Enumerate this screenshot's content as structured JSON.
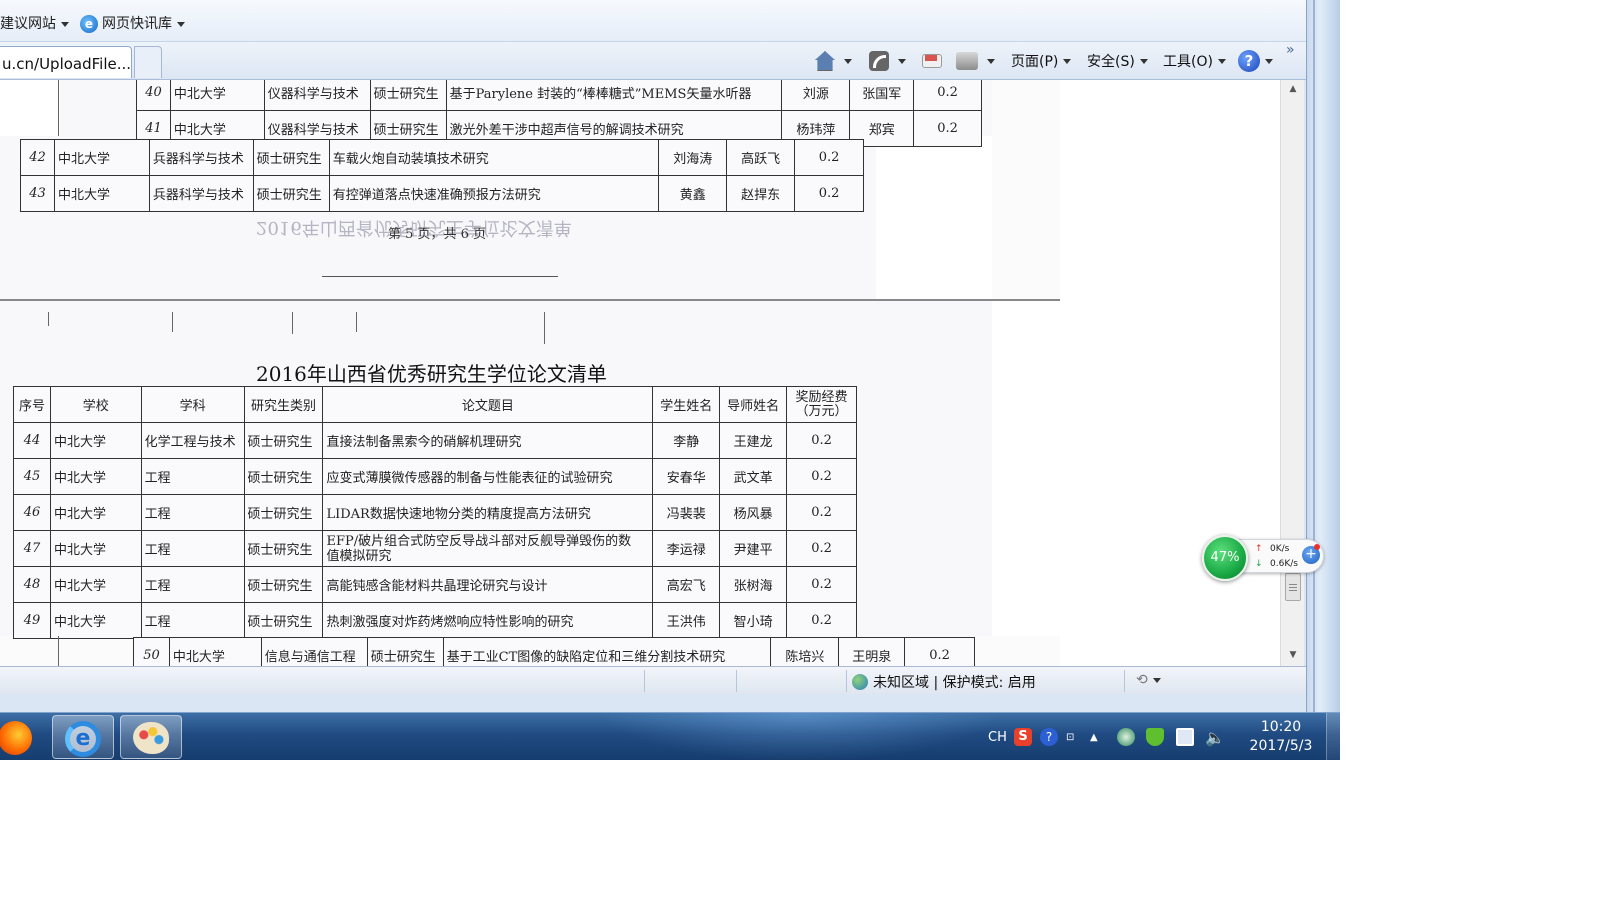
{
  "browser": {
    "favorites_bar": {
      "items": [
        {
          "label": "建议网站"
        },
        {
          "label": "网页快讯库"
        }
      ]
    },
    "tab": {
      "title": "u.cn/UploadFile..."
    },
    "commands": {
      "page": "页面(P)",
      "safety": "安全(S)",
      "tools": "工具(O)"
    },
    "status_bar": {
      "zone": "未知区域 | 保护模式: 启用"
    }
  },
  "document": {
    "prev_rows": [
      {
        "no": "40",
        "school": "中北大学",
        "subject": "仪器科学与技术",
        "type": "硕士研究生",
        "title": "基于Parylene 封装的“棒棒糖式”MEMS矢量水听器",
        "student": "刘源",
        "advisor": "张国军",
        "funding": "0.2"
      },
      {
        "no": "41",
        "school": "中北大学",
        "subject": "仪器科学与技术",
        "type": "硕士研究生",
        "title": "激光外差干涉中超声信号的解调技术研究",
        "student": "杨玮萍",
        "advisor": "郑宾",
        "funding": "0.2"
      },
      {
        "no": "42",
        "school": "中北大学",
        "subject": "兵器科学与技术",
        "type": "硕士研究生",
        "title": "车载火炮自动装填技术研究",
        "student": "刘海涛",
        "advisor": "高跃飞",
        "funding": "0.2"
      },
      {
        "no": "43",
        "school": "中北大学",
        "subject": "兵器科学与技术",
        "type": "硕士研究生",
        "title": "有控弹道落点快速准确预报方法研究",
        "student": "黄鑫",
        "advisor": "赵捍东",
        "funding": "0.2"
      }
    ],
    "page_footer": "第 5 页，共 6 页",
    "ghost_text": "2016年山西省优秀研究生学位论文清单",
    "title": "2016年山西省优秀研究生学位论文清单",
    "headers": {
      "no": "序号",
      "school": "学校",
      "subject": "学科",
      "type": "研究生类别",
      "title": "论文题目",
      "student": "学生姓名",
      "advisor": "导师姓名",
      "funding_1": "奖励经费",
      "funding_2": "（万元）"
    },
    "rows": [
      {
        "no": "44",
        "school": "中北大学",
        "subject": "化学工程与技术",
        "type": "硕士研究生",
        "title": "直接法制备黑索今的硝解机理研究",
        "student": "李静",
        "advisor": "王建龙",
        "funding": "0.2"
      },
      {
        "no": "45",
        "school": "中北大学",
        "subject": "工程",
        "type": "硕士研究生",
        "title": "应变式薄膜微传感器的制备与性能表征的试验研究",
        "student": "安春华",
        "advisor": "武文革",
        "funding": "0.2"
      },
      {
        "no": "46",
        "school": "中北大学",
        "subject": "工程",
        "type": "硕士研究生",
        "title": "LIDAR数据快速地物分类的精度提高方法研究",
        "student": "冯裴裴",
        "advisor": "杨风暴",
        "funding": "0.2"
      },
      {
        "no": "47",
        "school": "中北大学",
        "subject": "工程",
        "type": "硕士研究生",
        "title_1": "EFP/破片组合式防空反导战斗部对反舰导弹毁伤的数",
        "title_2": "值模拟研究",
        "student": "李运禄",
        "advisor": "尹建平",
        "funding": "0.2"
      },
      {
        "no": "48",
        "school": "中北大学",
        "subject": "工程",
        "type": "硕士研究生",
        "title": "高能钝感含能材料共晶理论研究与设计",
        "student": "高宏飞",
        "advisor": "张树海",
        "funding": "0.2"
      },
      {
        "no": "49",
        "school": "中北大学",
        "subject": "工程",
        "type": "硕士研究生",
        "title": "热刺激强度对炸药烤燃响应特性影响的研究",
        "student": "王洪伟",
        "advisor": "智小琦",
        "funding": "0.2"
      }
    ],
    "next_row": {
      "no": "50",
      "school": "中北大学",
      "subject": "信息与通信工程",
      "type": "硕士研究生",
      "title": "基于工业CT图像的缺陷定位和三维分割技术研究",
      "student": "陈培兴",
      "advisor": "王明泉",
      "funding": "0.2"
    }
  },
  "taskbar": {
    "language": "CH",
    "time": "10:20",
    "date": "2017/5/3"
  },
  "speed_widget": {
    "percent": "47%",
    "upload": "0K/s",
    "download": "0.6K/s"
  }
}
